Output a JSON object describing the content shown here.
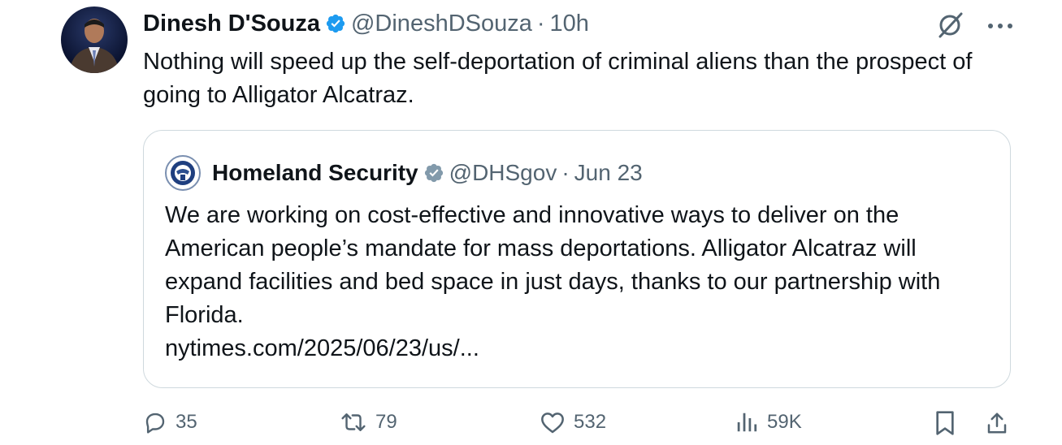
{
  "tweet": {
    "author_name": "Dinesh D'Souza",
    "author_handle": "@DineshDSouza",
    "separator": "·",
    "time": "10h",
    "text": "Nothing will speed up the self-deportation of criminal aliens than the prospect of going to Alligator Alcatraz."
  },
  "quoted": {
    "author_name": "Homeland Security",
    "author_handle": "@DHSgov",
    "separator": "·",
    "date": "Jun 23",
    "text": "We are working on cost-effective and innovative ways to deliver on the American people’s mandate for mass deportations. Alligator Alcatraz will expand facilities and bed space in just days, thanks to our partnership with Florida.",
    "link": "nytimes.com/2025/06/23/us/..."
  },
  "actions": {
    "replies": "35",
    "reposts": "79",
    "likes": "532",
    "views": "59K"
  },
  "icons": {
    "verified_author": "verified-blue-badge",
    "verified_quoted": "verified-gray-badge",
    "grok": "grok-icon",
    "more": "more-icon",
    "reply": "reply-icon",
    "repost": "repost-icon",
    "like": "like-icon",
    "views": "views-icon",
    "bookmark": "bookmark-icon",
    "share": "share-icon"
  },
  "colors": {
    "text": "#0f1419",
    "muted": "#536471",
    "verified_blue": "#1d9bf0",
    "verified_gray": "#829aab",
    "border": "#cfd9de"
  }
}
